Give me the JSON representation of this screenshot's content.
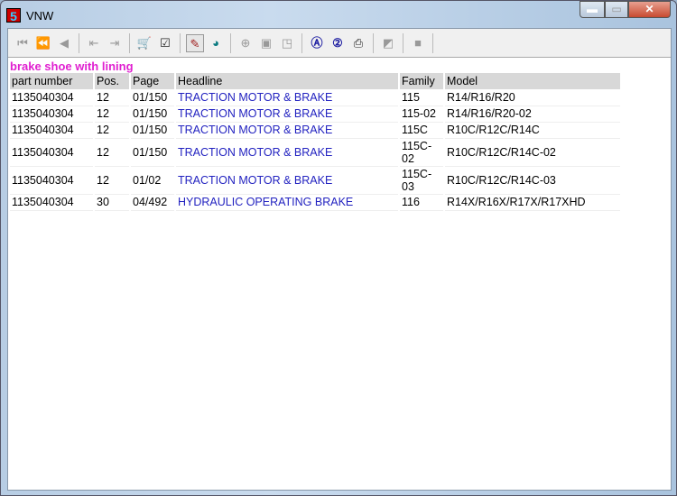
{
  "window": {
    "title": "VNW",
    "logo": "5"
  },
  "toolbar": {
    "icons": [
      "first-icon",
      "previous-page-icon",
      "previous-icon",
      "export-icon",
      "import-icon",
      "cart-icon",
      "checklist-icon",
      "filter-icon",
      "clock-icon",
      "zoom-in-icon",
      "page-icon",
      "page-corner-icon",
      "search-a-icon",
      "search-2-icon",
      "print-icon",
      "note-icon",
      "stop-icon"
    ]
  },
  "heading": "brake shoe with lining",
  "table": {
    "headers": [
      "part number",
      "Pos.",
      "Page",
      "Headline",
      "Family",
      "Model"
    ],
    "rows": [
      [
        "1135040304",
        "12",
        "01/150",
        "TRACTION MOTOR & BRAKE",
        "115",
        "R14/R16/R20"
      ],
      [
        "1135040304",
        "12",
        "01/150",
        "TRACTION MOTOR & BRAKE",
        "115-02",
        "R14/R16/R20-02"
      ],
      [
        "1135040304",
        "12",
        "01/150",
        "TRACTION MOTOR & BRAKE",
        "115C",
        "R10C/R12C/R14C"
      ],
      [
        "1135040304",
        "12",
        "01/150",
        "TRACTION MOTOR & BRAKE",
        "115C-02",
        "R10C/R12C/R14C-02"
      ],
      [
        "1135040304",
        "12",
        "01/02",
        "TRACTION MOTOR & BRAKE",
        "115C-03",
        "R10C/R12C/R14C-03"
      ],
      [
        "1135040304",
        "30",
        "04/492",
        "HYDRAULIC OPERATING BRAKE",
        "116",
        "R14X/R16X/R17X/R17XHD"
      ]
    ]
  }
}
